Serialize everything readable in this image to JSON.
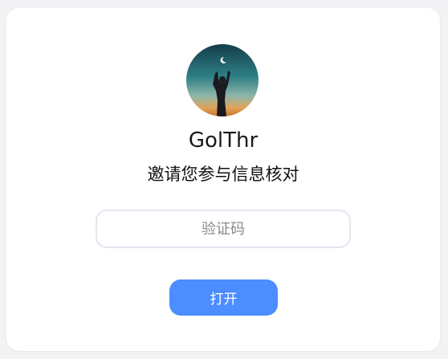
{
  "profile": {
    "username": "GolThr",
    "invite_text": "邀请您参与信息核对"
  },
  "form": {
    "code_placeholder": "验证码",
    "code_value": "",
    "open_label": "打开"
  },
  "colors": {
    "accent": "#4c8dff",
    "input_border": "#e6e4ef",
    "card_bg": "#ffffff",
    "page_bg": "#f3f3f5"
  },
  "icons": {
    "avatar": "avatar-silhouette-moon-image"
  }
}
